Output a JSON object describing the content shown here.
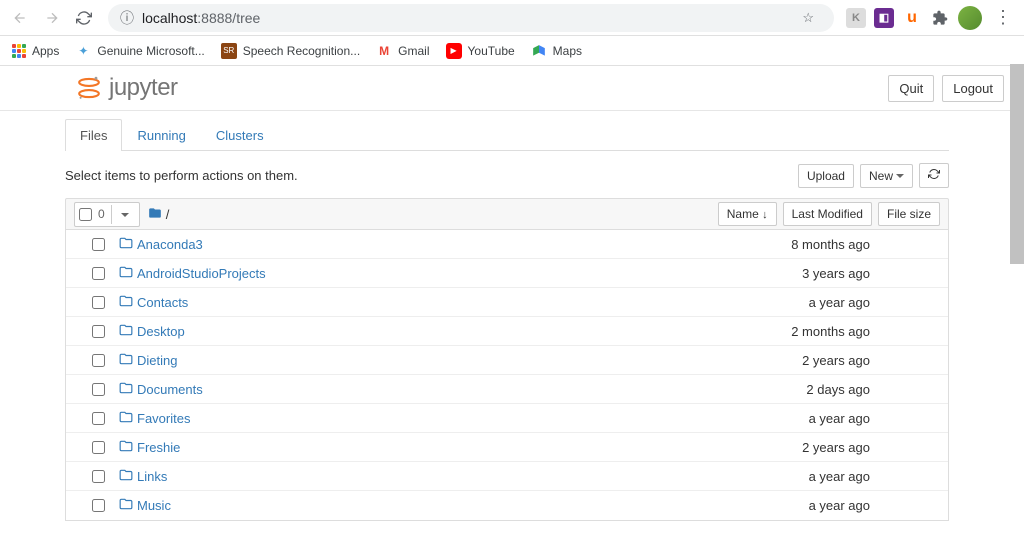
{
  "browser": {
    "url_host": "localhost",
    "url_port_path": ":8888/tree"
  },
  "bookmarks": [
    {
      "label": "Apps",
      "icon": "apps"
    },
    {
      "label": "Genuine Microsoft...",
      "icon": "ms"
    },
    {
      "label": "Speech Recognition...",
      "icon": "sr"
    },
    {
      "label": "Gmail",
      "icon": "gmail"
    },
    {
      "label": "YouTube",
      "icon": "yt"
    },
    {
      "label": "Maps",
      "icon": "maps"
    }
  ],
  "header": {
    "logo_text": "jupyter",
    "quit": "Quit",
    "logout": "Logout"
  },
  "tabs": [
    {
      "label": "Files",
      "active": true
    },
    {
      "label": "Running",
      "active": false
    },
    {
      "label": "Clusters",
      "active": false
    }
  ],
  "toolbar": {
    "hint": "Select items to perform actions on them.",
    "upload": "Upload",
    "new": "New",
    "select_count": "0"
  },
  "list_header": {
    "name": "Name",
    "last_modified": "Last Modified",
    "file_size": "File size",
    "breadcrumb_root": "/"
  },
  "files": [
    {
      "name": "Anaconda3",
      "modified": "8 months ago"
    },
    {
      "name": "AndroidStudioProjects",
      "modified": "3 years ago"
    },
    {
      "name": "Contacts",
      "modified": "a year ago"
    },
    {
      "name": "Desktop",
      "modified": "2 months ago"
    },
    {
      "name": "Dieting",
      "modified": "2 years ago"
    },
    {
      "name": "Documents",
      "modified": "2 days ago"
    },
    {
      "name": "Favorites",
      "modified": "a year ago"
    },
    {
      "name": "Freshie",
      "modified": "2 years ago"
    },
    {
      "name": "Links",
      "modified": "a year ago"
    },
    {
      "name": "Music",
      "modified": "a year ago"
    }
  ]
}
